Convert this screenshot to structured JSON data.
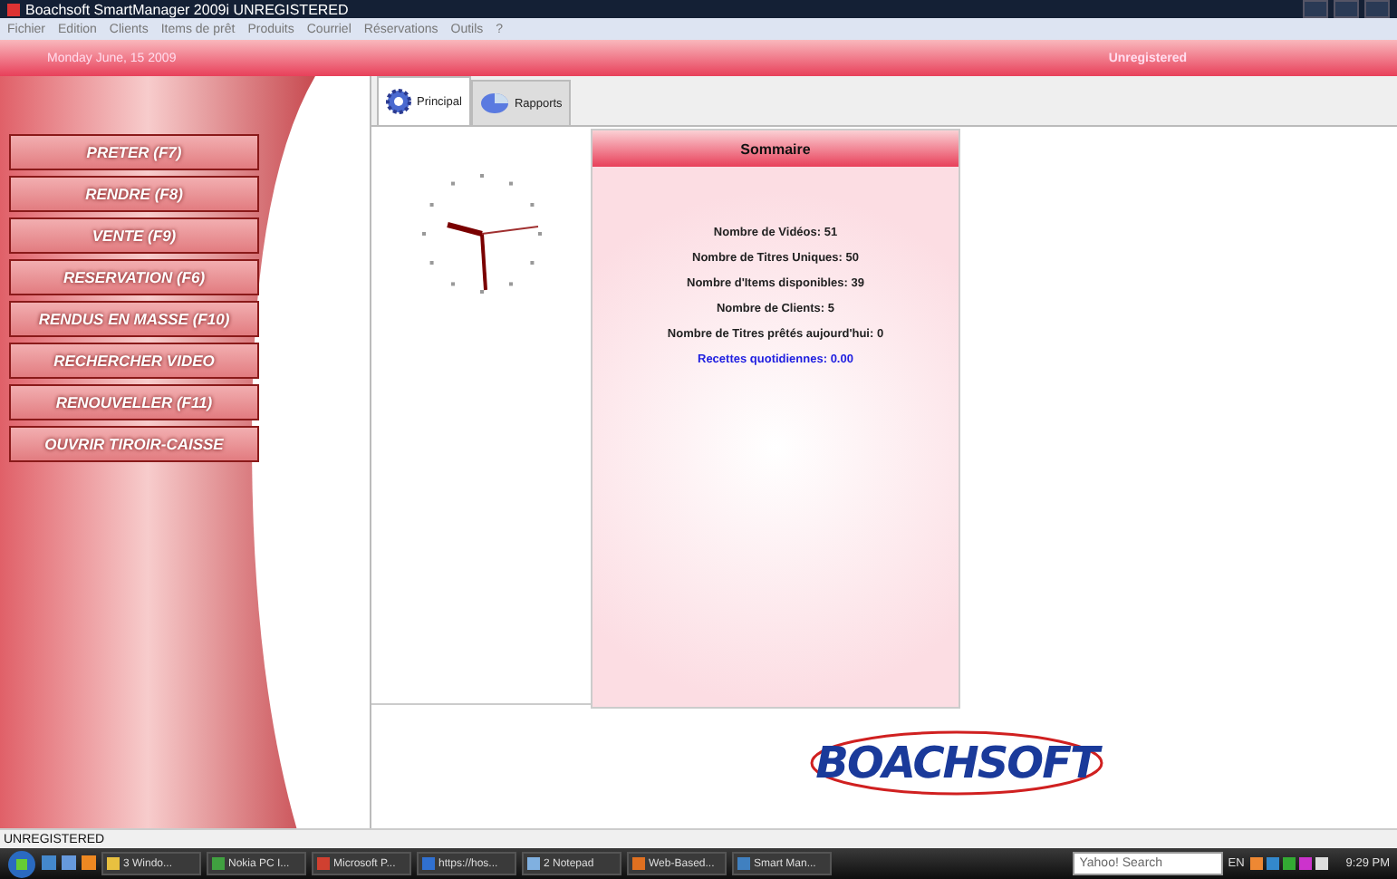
{
  "window": {
    "title": "Boachsoft SmartManager 2009i  UNREGISTERED"
  },
  "menu": [
    "Fichier",
    "Edition",
    "Clients",
    "Items de prêt",
    "Produits",
    "Courriel",
    "Réservations",
    "Outils",
    "?"
  ],
  "header": {
    "date": "Monday June, 15 2009",
    "registration": "Unregistered"
  },
  "actions": [
    "PRETER (F7)",
    "RENDRE (F8)",
    "VENTE (F9)",
    "RESERVATION (F6)",
    "RENDUS EN MASSE (F10)",
    "RECHERCHER VIDEO",
    "RENOUVELLER (F11)",
    "OUVRIR TIROIR-CAISSE"
  ],
  "tabs": [
    {
      "label": "Principal",
      "selected": true,
      "kind": "gear"
    },
    {
      "label": "Rapports",
      "selected": false,
      "kind": "pie"
    }
  ],
  "summary": {
    "title": "Sommaire",
    "stats": [
      {
        "text": "Nombre de Vidéos: 51",
        "kind": "stat"
      },
      {
        "text": "Nombre de Titres Uniques: 50",
        "kind": "stat"
      },
      {
        "text": "Nombre d'Items disponibles: 39",
        "kind": "stat"
      },
      {
        "text": "Nombre de Clients: 5",
        "kind": "stat"
      },
      {
        "text": "Nombre de Titres prêtés aujourd'hui: 0",
        "kind": "stat"
      },
      {
        "text": "Recettes quotidiennes:  0.00",
        "kind": "revenue"
      }
    ]
  },
  "logo": "BOACHSOFT",
  "status_bar": "UNREGISTERED",
  "taskbar": {
    "items": [
      {
        "label": "3 Windo...",
        "color": "#e8c040"
      },
      {
        "label": "Nokia PC I...",
        "color": "#40a040"
      },
      {
        "label": "Microsoft P...",
        "color": "#d04030"
      },
      {
        "label": "https://hos...",
        "color": "#3070d0"
      },
      {
        "label": "2 Notepad",
        "color": "#80b0e0"
      },
      {
        "label": "Web-Based...",
        "color": "#e07020"
      },
      {
        "label": "Smart Man...",
        "color": "#4080c0"
      }
    ],
    "search_placeholder": "Yahoo! Search",
    "language": "EN",
    "time": "9:29 PM"
  }
}
